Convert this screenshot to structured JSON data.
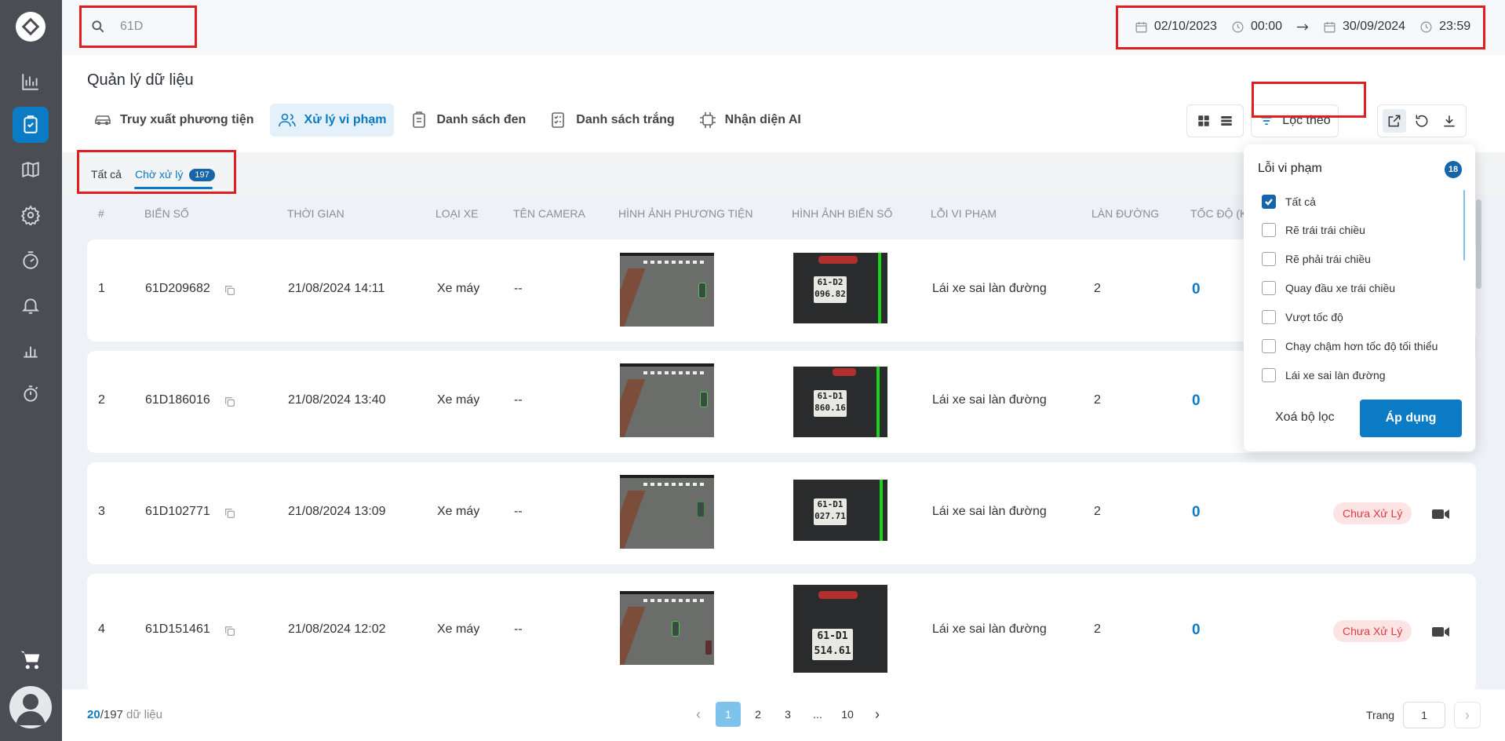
{
  "search": {
    "value": "61D"
  },
  "daterange": {
    "start_date": "02/10/2023",
    "start_time": "00:00",
    "end_date": "30/09/2024",
    "end_time": "23:59"
  },
  "page": {
    "title": "Quản lý dữ liệu"
  },
  "tabs": [
    {
      "label": "Truy xuất phương tiện",
      "icon": "car-icon"
    },
    {
      "label": "Xử lý vi phạm",
      "icon": "users-icon",
      "active": true
    },
    {
      "label": "Danh sách đen",
      "icon": "clipboard-icon"
    },
    {
      "label": "Danh sách trắng",
      "icon": "checklist-icon"
    },
    {
      "label": "Nhận diện AI",
      "icon": "ai-chip-icon"
    }
  ],
  "toolbar": {
    "filter_label": "Lọc theo"
  },
  "subtabs": {
    "all": "Tất cả",
    "pending": "Chờ xử lý",
    "pending_count": "197"
  },
  "table": {
    "headers": [
      "#",
      "Biển số",
      "Thời gian",
      "Loại xe",
      "Tên camera",
      "Hình ảnh phương tiện",
      "Hình ảnh biển số",
      "Lỗi vi phạm",
      "Làn đường",
      "Tốc độ (K"
    ],
    "rows": [
      {
        "index": "1",
        "plate": "61D209682",
        "time": "21/08/2024 14:11",
        "type": "Xe máy",
        "camera": "--",
        "plate_img": [
          "61-D2",
          "096.82"
        ],
        "violation": "Lái xe sai làn đường",
        "lane": "2",
        "speed": "0",
        "status": ""
      },
      {
        "index": "2",
        "plate": "61D186016",
        "time": "21/08/2024 13:40",
        "type": "Xe máy",
        "camera": "--",
        "plate_img": [
          "61-D1",
          "860.16"
        ],
        "violation": "Lái xe sai làn đường",
        "lane": "2",
        "speed": "0",
        "status": ""
      },
      {
        "index": "3",
        "plate": "61D102771",
        "time": "21/08/2024 13:09",
        "type": "Xe máy",
        "camera": "--",
        "plate_img": [
          "61-D1",
          "027.71"
        ],
        "violation": "Lái xe sai làn đường",
        "lane": "2",
        "speed": "0",
        "status": "Chưa Xử Lý"
      },
      {
        "index": "4",
        "plate": "61D151461",
        "time": "21/08/2024 12:02",
        "type": "Xe máy",
        "camera": "--",
        "plate_img": [
          "61-D1",
          "514.61"
        ],
        "violation": "Lái xe sai làn đường",
        "lane": "2",
        "speed": "0",
        "status": "Chưa Xử Lý"
      }
    ]
  },
  "footer": {
    "shown": "20",
    "total": "/197",
    "suffix": " dữ liệu",
    "pages": [
      "1",
      "2",
      "3",
      "...",
      "10"
    ],
    "current_page": "1",
    "page_label": "Trang",
    "page_input": "1"
  },
  "filter_dropdown": {
    "title": "Lỗi vi phạm",
    "count": "18",
    "options": [
      {
        "label": "Tất cả",
        "checked": true
      },
      {
        "label": "Rẽ trái trái chiều",
        "checked": false
      },
      {
        "label": "Rẽ phải trái chiều",
        "checked": false
      },
      {
        "label": "Quay đầu xe trái chiều",
        "checked": false
      },
      {
        "label": "Vượt tốc độ",
        "checked": false
      },
      {
        "label": "Chạy chậm hơn tốc độ tối thiểu",
        "checked": false
      },
      {
        "label": "Lái xe sai làn đường",
        "checked": false
      }
    ],
    "clear_label": "Xoá bộ lọc",
    "apply_label": "Áp dụng"
  },
  "colors": {
    "accent": "#0a7bc4",
    "sidebar": "#4a4d53",
    "highlight": "#e02020",
    "status_bg": "#fde4e4",
    "status_text": "#e0393e"
  }
}
